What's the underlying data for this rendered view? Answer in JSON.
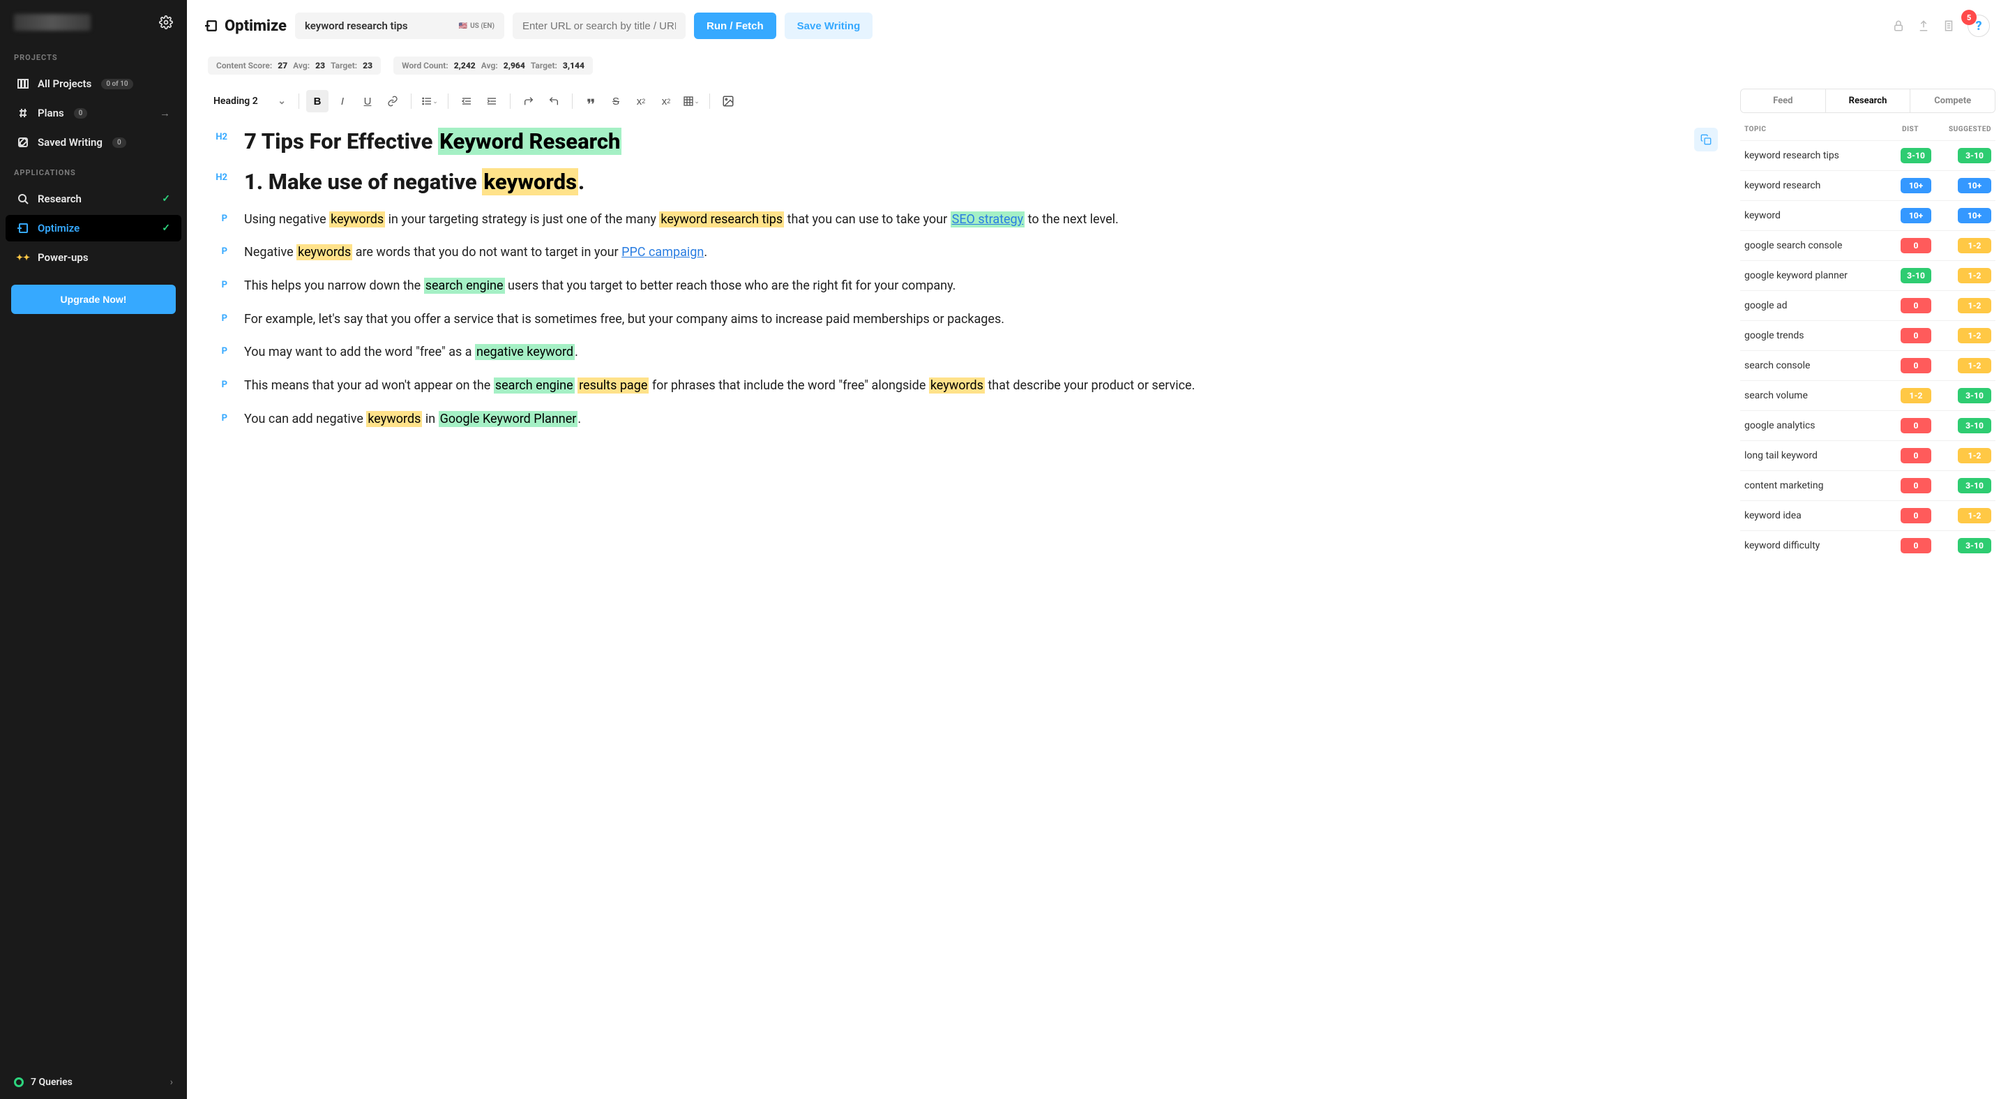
{
  "sidebar": {
    "sections": {
      "projects_label": "PROJECTS",
      "applications_label": "APPLICATIONS"
    },
    "items": {
      "all_projects": {
        "label": "All Projects",
        "badge": "0 of 10"
      },
      "plans": {
        "label": "Plans",
        "badge": "0"
      },
      "saved_writing": {
        "label": "Saved Writing",
        "badge": "0"
      },
      "research": {
        "label": "Research"
      },
      "optimize": {
        "label": "Optimize"
      },
      "powerups": {
        "label": "Power-ups"
      }
    },
    "upgrade": "Upgrade Now!",
    "footer": {
      "queries": "7 Queries"
    }
  },
  "topbar": {
    "title": "Optimize",
    "keyword_value": "keyword research tips",
    "locale": "US (EN)",
    "url_placeholder": "Enter URL or search by title / URL",
    "run": "Run / Fetch",
    "save": "Save Writing",
    "notifications": "5"
  },
  "stats": {
    "content_score_label": "Content Score:",
    "content_score": "27",
    "cs_avg_label": "Avg:",
    "cs_avg": "23",
    "cs_target_label": "Target:",
    "cs_target": "23",
    "word_count_label": "Word Count:",
    "word_count": "2,242",
    "wc_avg_label": "Avg:",
    "wc_avg": "2,964",
    "wc_target_label": "Target:",
    "wc_target": "3,144"
  },
  "toolbar": {
    "heading": "Heading 2"
  },
  "content": {
    "h2a_pre": "7 Tips For Effective ",
    "h2a_mark": "Keyword Research",
    "h2b_pre": "1. Make use of negative ",
    "h2b_mark": "keywords",
    "h2b_post": ".",
    "p1_a": "Using negative ",
    "p1_m1": "keywords",
    "p1_b": " in your targeting strategy is just one of the many ",
    "p1_m2": "keyword research tips",
    "p1_c": " that you can use to take your ",
    "p1_m3": "SEO strategy",
    "p1_d": " to the next level.",
    "p2_a": "Negative ",
    "p2_m1": "keywords",
    "p2_b": " are words that you do not want to target in your ",
    "p2_link": "PPC campaign",
    "p2_c": ".",
    "p3_a": "This helps you narrow down the ",
    "p3_m1": "search engine",
    "p3_b": " users that you target to better reach those who are the right fit for your company.",
    "p4": "For example, let's say that you offer a service that is sometimes free, but your company aims to increase paid memberships or packages.",
    "p5_a": "You may want to add the word \"free\" as a ",
    "p5_m1": "negative keyword",
    "p5_b": ".",
    "p6_a": "This means that your ad won't appear on the ",
    "p6_m1": "search engine",
    "p6_m2": "results page",
    "p6_b": " for phrases that include the word \"free\" alongside ",
    "p6_m3": "keywords",
    "p6_c": " that describe your product or service.",
    "p7_a": "You can add negative ",
    "p7_m1": "keywords",
    "p7_b": " in ",
    "p7_m2": "Google Keyword Planner",
    "p7_c": "."
  },
  "rpanel": {
    "tabs": {
      "feed": "Feed",
      "research": "Research",
      "compete": "Compete"
    },
    "headers": {
      "topic": "TOPIC",
      "dist": "DIST",
      "suggested": "SUGGESTED"
    },
    "rows": [
      {
        "topic": "keyword research tips",
        "dist": "3-10",
        "dcol": "green",
        "sug": "3-10",
        "scol": "green"
      },
      {
        "topic": "keyword research",
        "dist": "10+",
        "dcol": "blue",
        "sug": "10+",
        "scol": "blue"
      },
      {
        "topic": "keyword",
        "dist": "10+",
        "dcol": "blue",
        "sug": "10+",
        "scol": "blue"
      },
      {
        "topic": "google search console",
        "dist": "0",
        "dcol": "red",
        "sug": "1-2",
        "scol": "yellow"
      },
      {
        "topic": "google keyword planner",
        "dist": "3-10",
        "dcol": "green",
        "sug": "1-2",
        "scol": "yellow"
      },
      {
        "topic": "google ad",
        "dist": "0",
        "dcol": "red",
        "sug": "1-2",
        "scol": "yellow"
      },
      {
        "topic": "google trends",
        "dist": "0",
        "dcol": "red",
        "sug": "1-2",
        "scol": "yellow"
      },
      {
        "topic": "search console",
        "dist": "0",
        "dcol": "red",
        "sug": "1-2",
        "scol": "yellow"
      },
      {
        "topic": "search volume",
        "dist": "1-2",
        "dcol": "yellow",
        "sug": "3-10",
        "scol": "green"
      },
      {
        "topic": "google analytics",
        "dist": "0",
        "dcol": "red",
        "sug": "3-10",
        "scol": "green"
      },
      {
        "topic": "long tail keyword",
        "dist": "0",
        "dcol": "red",
        "sug": "1-2",
        "scol": "yellow"
      },
      {
        "topic": "content marketing",
        "dist": "0",
        "dcol": "red",
        "sug": "3-10",
        "scol": "green"
      },
      {
        "topic": "keyword idea",
        "dist": "0",
        "dcol": "red",
        "sug": "1-2",
        "scol": "yellow"
      },
      {
        "topic": "keyword difficulty",
        "dist": "0",
        "dcol": "red",
        "sug": "3-10",
        "scol": "green"
      }
    ]
  }
}
